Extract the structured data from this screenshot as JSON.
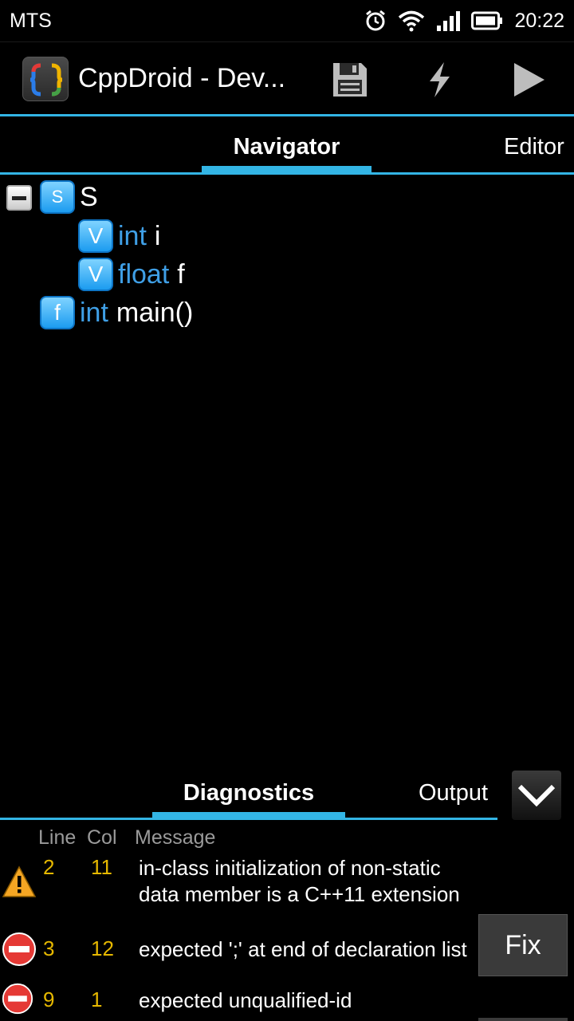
{
  "status_bar": {
    "carrier": "MTS",
    "time": "20:22",
    "icons": [
      "alarm-icon",
      "wifi-icon",
      "signal-icon",
      "battery-icon"
    ]
  },
  "action_bar": {
    "app_title": "CppDroid - Dev...",
    "actions": [
      "save-icon",
      "build-icon",
      "run-icon"
    ]
  },
  "top_tabs": {
    "navigator": "Navigator",
    "editor": "Editor",
    "selected": "Navigator"
  },
  "tree": {
    "struct": {
      "badge": "S",
      "name": "S",
      "expanded": true
    },
    "members": [
      {
        "badge": "V",
        "type": "int",
        "name": "i"
      },
      {
        "badge": "V",
        "type": "float",
        "name": "f"
      }
    ],
    "function": {
      "badge": "f",
      "type": "int",
      "name": "main()"
    }
  },
  "bottom_tabs": {
    "diagnostics": "Diagnostics",
    "output": "Output",
    "selected": "Diagnostics"
  },
  "diagnostics": {
    "headers": {
      "line": "Line",
      "col": "Col",
      "message": "Message"
    },
    "rows": [
      {
        "severity": "warning",
        "line": "2",
        "col": "11",
        "message": "in-class initialization of non-static data member is a C++11 extension"
      },
      {
        "severity": "error",
        "line": "3",
        "col": "12",
        "message": "expected ';' at end of declaration list"
      },
      {
        "severity": "error",
        "line": "9",
        "col": "1",
        "message": "expected unqualified-id"
      }
    ],
    "fix_label": "Fix"
  },
  "colors": {
    "accent": "#33b5e5",
    "keyword": "#3f9fe6",
    "numbers": "#e6b800"
  }
}
